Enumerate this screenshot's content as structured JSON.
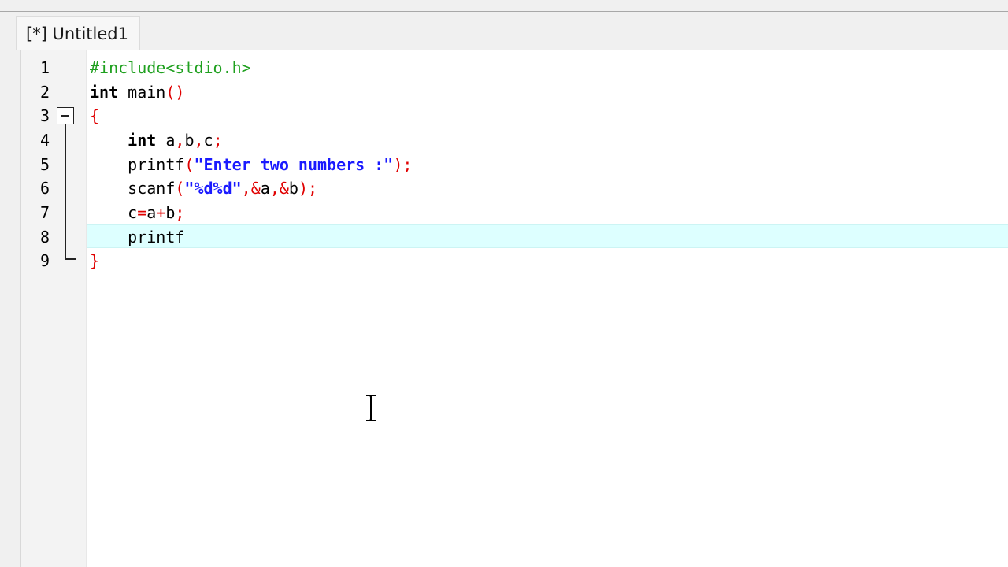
{
  "tabs": [
    {
      "label": "[*] Untitled1"
    }
  ],
  "editor": {
    "line_numbers": [
      "1",
      "2",
      "3",
      "4",
      "5",
      "6",
      "7",
      "8",
      "9"
    ],
    "current_line": 8,
    "code": {
      "l1": {
        "t1": "#include<stdio.h>"
      },
      "l2": {
        "t1": "int",
        "t2": " main",
        "t3": "()"
      },
      "l3": {
        "t1": "{"
      },
      "l4": {
        "t1": "    ",
        "t2": "int",
        "t3": " a",
        "t4": ",",
        "t5": "b",
        "t6": ",",
        "t7": "c",
        "t8": ";"
      },
      "l5": {
        "t1": "    printf",
        "t2": "(",
        "t3": "\"Enter two numbers :\"",
        "t4": ");"
      },
      "l6": {
        "t1": "    scanf",
        "t2": "(",
        "t3": "\"%d%d\"",
        "t4": ",&",
        "t5": "a",
        "t6": ",&",
        "t7": "b",
        "t8": ");"
      },
      "l7": {
        "t1": "    c",
        "t2": "=",
        "t3": "a",
        "t4": "+",
        "t5": "b",
        "t6": ";"
      },
      "l8": {
        "t1": "    printf"
      },
      "l9": {
        "t1": "}"
      }
    }
  },
  "colors": {
    "preprocessor": "#1fa01f",
    "symbol": "#e00000",
    "string": "#1a1aff",
    "current_line_bg": "#ddffff"
  }
}
